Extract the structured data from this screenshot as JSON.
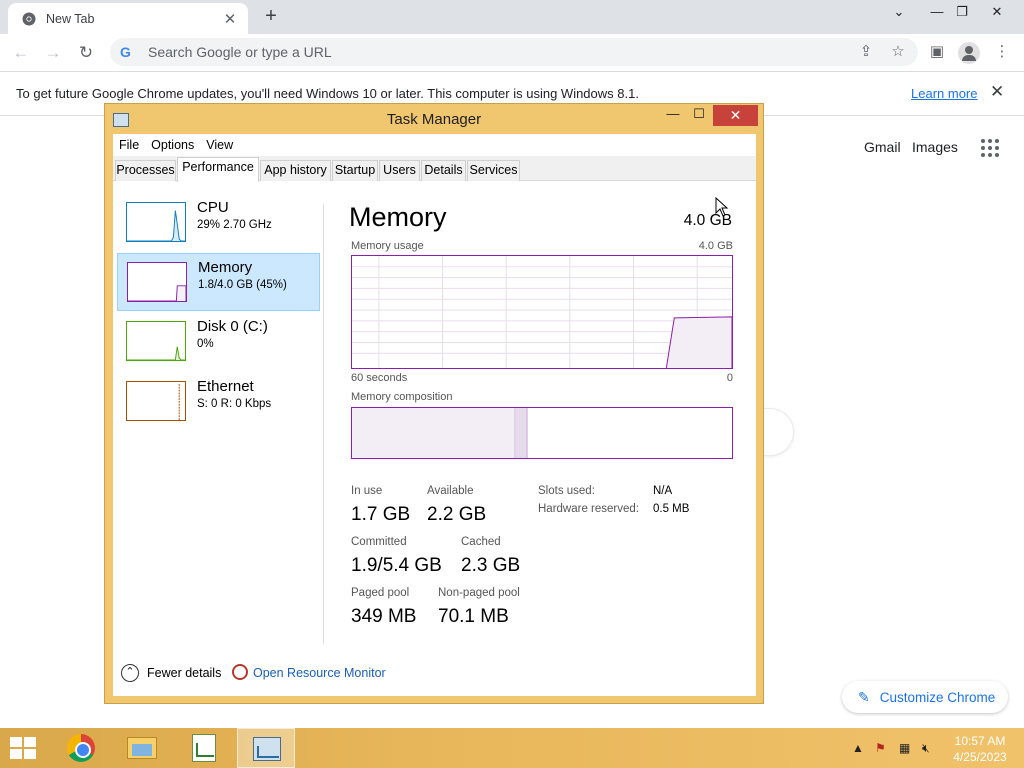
{
  "browser": {
    "tab_title": "New Tab",
    "omnibox_placeholder": "Search Google or type a URL",
    "infobar_text": "To get future Google Chrome updates, you'll need Windows 10 or later. This computer is using Windows 8.1.",
    "infobar_link": "Learn more",
    "ntp_links": [
      "Gmail",
      "Images"
    ],
    "customize_label": "Customize Chrome",
    "accent": "#1a73e8"
  },
  "task_manager": {
    "title": "Task Manager",
    "menu": [
      "File",
      "Options",
      "View"
    ],
    "tabs": [
      "Processes",
      "Performance",
      "App history",
      "Startup",
      "Users",
      "Details",
      "Services"
    ],
    "active_tab": "Performance",
    "sidebar": [
      {
        "name": "CPU",
        "detail": "29%  2.70 GHz",
        "color": "#117dbb"
      },
      {
        "name": "Memory",
        "detail": "1.8/4.0 GB (45%)",
        "color": "#8b1fa9"
      },
      {
        "name": "Disk 0 (C:)",
        "detail": "0%",
        "color": "#4da60c"
      },
      {
        "name": "Ethernet",
        "detail": "S: 0  R: 0 Kbps",
        "color": "#a74f01"
      }
    ],
    "memory": {
      "title": "Memory",
      "total": "4.0 GB",
      "usage_label": "Memory usage",
      "usage_max": "4.0 GB",
      "time_left": "60 seconds",
      "time_right": "0",
      "composition_label": "Memory composition",
      "in_use_fraction": 0.43,
      "modified_fraction": 0.03,
      "stats": {
        "in_use_label": "In use",
        "in_use": "1.7 GB",
        "available_label": "Available",
        "available": "2.2 GB",
        "committed_label": "Committed",
        "committed": "1.9/5.4 GB",
        "cached_label": "Cached",
        "cached": "2.3 GB",
        "paged_label": "Paged pool",
        "paged": "349 MB",
        "nonpaged_label": "Non-paged pool",
        "nonpaged": "70.1 MB",
        "slots_label": "Slots used:",
        "slots": "N/A",
        "hwres_label": "Hardware reserved:",
        "hwres": "0.5 MB"
      }
    },
    "footer": {
      "fewer_details": "Fewer details",
      "open_resmon": "Open Resource Monitor"
    }
  },
  "taskbar": {
    "time": "10:57 AM",
    "date": "4/25/2023",
    "apps": [
      "chrome",
      "file-explorer",
      "notepad-plus-plus",
      "task-manager"
    ],
    "active_app": "task-manager"
  }
}
